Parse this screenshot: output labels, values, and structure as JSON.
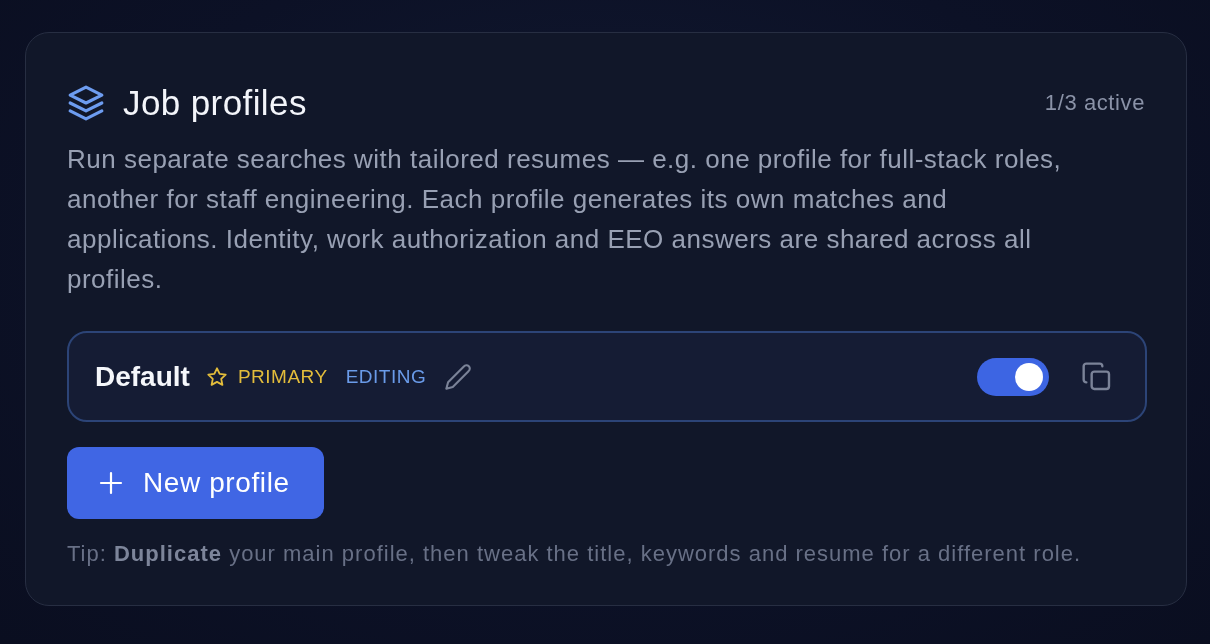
{
  "card": {
    "title": "Job profiles",
    "active_count": "1/3 active",
    "description": "Run separate searches with tailored resumes — e.g. one profile for full-stack roles, another for staff engineering. Each profile generates its own matches and applications. Identity, work authorization and EEO answers are shared across all profiles.",
    "profiles": [
      {
        "name": "Default",
        "badges": [
          {
            "kind": "primary",
            "label": "PRIMARY"
          },
          {
            "kind": "editing",
            "label": "EDITING"
          }
        ],
        "on": true
      }
    ],
    "new_button": "New profile",
    "tip": "Tip: **Duplicate** your main profile, then tweak the title, keywords and resume for a different role."
  }
}
